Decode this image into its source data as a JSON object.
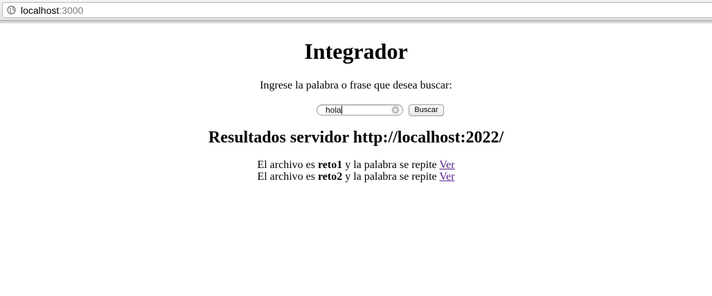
{
  "browser": {
    "url_host": "localhost",
    "url_port": ":3000"
  },
  "page": {
    "title": "Integrador",
    "prompt": "Ingrese la palabra o frase que desea buscar:",
    "search": {
      "value": "hola",
      "button_label": "Buscar"
    },
    "results_heading": "Resultados servidor http://localhost:2022/",
    "results": [
      {
        "prefix": "El archivo es ",
        "file": "reto1",
        "middle": " y la palabra se repite ",
        "link": "Ver"
      },
      {
        "prefix": "El archivo es ",
        "file": "reto2",
        "middle": " y la palabra se repite ",
        "link": "Ver"
      }
    ]
  },
  "colors": {
    "link_visited": "#551a8b",
    "background": "#ffffff"
  },
  "icons": {
    "address_icon": "globe-icon",
    "search_clear": "clear-icon"
  }
}
